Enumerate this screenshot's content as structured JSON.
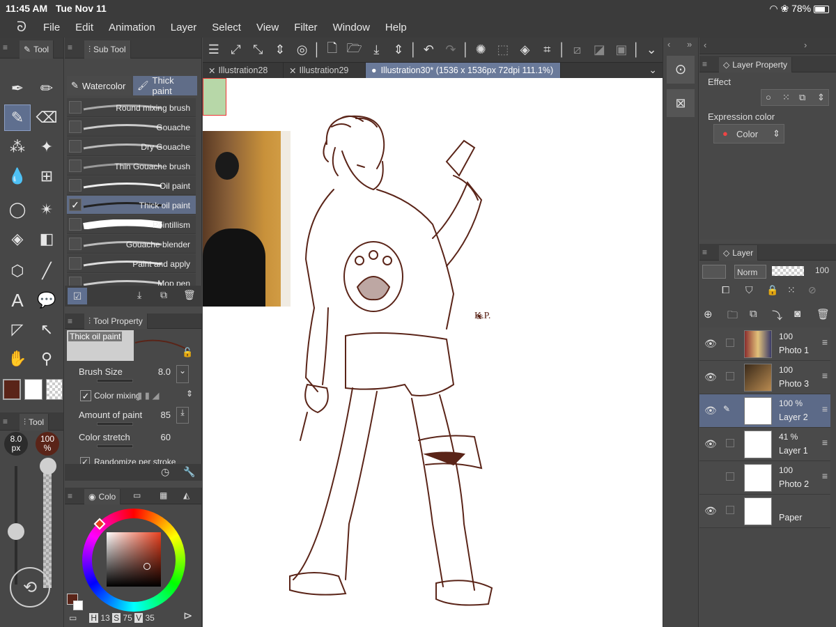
{
  "status": {
    "time": "11:45 AM",
    "date": "Tue Nov 11",
    "battery": "78%"
  },
  "menu": [
    "File",
    "Edit",
    "Animation",
    "Layer",
    "Select",
    "View",
    "Filter",
    "Window",
    "Help"
  ],
  "tool_panel": {
    "title": "Tool",
    "subtool_title": "Tool",
    "brush_size_badge": "8.0",
    "brush_size_unit": "px",
    "opacity_badge": "100",
    "opacity_unit": "%"
  },
  "sub_tool": {
    "title": "Sub Tool",
    "categories": [
      "Watercolor",
      "Thick paint"
    ],
    "active_category": "Thick paint",
    "brushes": [
      {
        "label": "Round mixing brush",
        "checked": false,
        "selected": false
      },
      {
        "label": "Gouache",
        "checked": false,
        "selected": false
      },
      {
        "label": "Dry Gouache",
        "checked": false,
        "selected": false
      },
      {
        "label": "Thin Gouache brush",
        "checked": false,
        "selected": false
      },
      {
        "label": "Oil paint",
        "checked": false,
        "selected": false
      },
      {
        "label": "Thick oil paint",
        "checked": true,
        "selected": true
      },
      {
        "label": "Pointillism",
        "checked": false,
        "selected": false
      },
      {
        "label": "Gouache blender",
        "checked": false,
        "selected": false
      },
      {
        "label": "Paint and apply",
        "checked": false,
        "selected": false
      },
      {
        "label": "Mop pen",
        "checked": false,
        "selected": false
      }
    ]
  },
  "tool_property": {
    "title": "Tool Property",
    "preset_name": "Thick oil paint",
    "brush_size": {
      "label": "Brush Size",
      "value": "8.0"
    },
    "color_mixing": {
      "label": "Color mixing",
      "checked": true
    },
    "amount_of_paint": {
      "label": "Amount of paint",
      "value": "85"
    },
    "color_stretch": {
      "label": "Color stretch",
      "value": "60"
    },
    "randomize": {
      "label": "Randomize per stroke",
      "checked": true
    }
  },
  "color_panel": {
    "tab_label": "Colo",
    "h_label": "H",
    "h_value": "13",
    "s_label": "S",
    "s_value": "75",
    "v_label": "V",
    "v_value": "35",
    "main_color": "#5a2418"
  },
  "doc_tabs": [
    {
      "label": "Illustration28",
      "active": false
    },
    {
      "label": "Illustration29",
      "active": false
    },
    {
      "label": "Illustration30* (1536 x 1536px 72dpi 111.1%)",
      "active": true
    }
  ],
  "canvas": {
    "signature": "K.P."
  },
  "layer_property": {
    "title": "Layer Property",
    "effect_label": "Effect",
    "expression_color_label": "Expression color",
    "expression_color_value": "Color"
  },
  "layer_panel": {
    "title": "Layer",
    "blend_mode": "Norm",
    "opacity": "100",
    "layers": [
      {
        "name": "Photo 1",
        "opacity": "100",
        "visible": true,
        "selected": false
      },
      {
        "name": "Photo 3",
        "opacity": "100",
        "visible": true,
        "selected": false
      },
      {
        "name": "Layer 2",
        "opacity": "100 %",
        "visible": true,
        "selected": true
      },
      {
        "name": "Layer 1",
        "opacity": "41 %",
        "visible": true,
        "selected": false
      },
      {
        "name": "Photo 2",
        "opacity": "100",
        "visible": false,
        "selected": false
      },
      {
        "name": "Paper",
        "opacity": "",
        "visible": true,
        "selected": false
      }
    ]
  }
}
